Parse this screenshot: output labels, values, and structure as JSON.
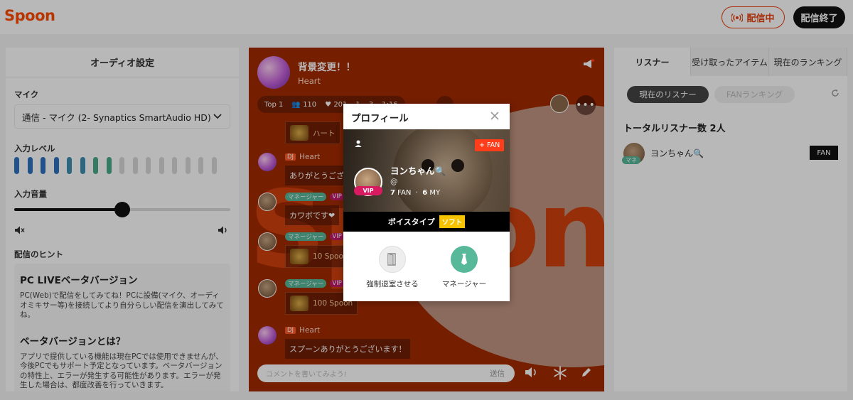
{
  "header": {
    "logo": "Spoon",
    "live_label": "配信中",
    "end_label": "配信終了"
  },
  "audio": {
    "title": "オーディオ設定",
    "mic_label": "マイク",
    "mic_value": "通信 - マイク (2- Synaptics SmartAudio HD)",
    "input_level_label": "入力レベル",
    "level_bars_active": 8,
    "level_bars_total": 16,
    "volume_label": "入力音量",
    "volume_fraction": 0.5,
    "tips_title": "配信のヒント",
    "tip1_title": "PC LIVEベータバージョン",
    "tip1_body": "PC(Web)で配信をしてみてね！PCに設備(マイク、オーディオミキサー等)を接続してより自分らしい配信を演出してみてね。",
    "tip2_title": "ベータバージョンとは？",
    "tip2_body": "アプリで提供している機能は現在PCでは使用できませんが、今後PCでもサポート予定となっています。ベータバージョンの特性上、エラーが発生する可能性があります。エラーが発生した場合は、都度改善を行っていきます。"
  },
  "room": {
    "title": "背景変更！！",
    "subtitle": "Heart",
    "bg_word": "Spoon",
    "stat_rank": "Top 1",
    "stat_listeners": "110",
    "stat_likes": "201",
    "stat_a": "1",
    "stat_b": "3",
    "stat_c": "1:16",
    "more": "•••",
    "messages": {
      "gift_top": "ハート",
      "m1_tag": "DJ",
      "m1_name": "Heart",
      "m1_text": "ありがとうございます",
      "m2_tag": "マネージャー",
      "m2_vip": "VIP",
      "m2_text": "カワボです❤",
      "m3_tag": "マネージャー",
      "m3_vip": "VIP",
      "m3_gift": "10 Spoon",
      "m4_tag": "マネージャー",
      "m4_vip": "VIP",
      "m4_gift": "100 Spoon",
      "m5_tag": "DJ",
      "m5_name": "Heart",
      "m5_text": "スプーンありがとうございます！"
    },
    "composer_placeholder": "コメントを書いてみよう!",
    "send_label": "送信"
  },
  "listeners": {
    "tabs": [
      "リスナー",
      "受け取ったアイテム",
      "現在のランキング"
    ],
    "filter_current": "現在のリスナー",
    "filter_fan": "FANランキング",
    "total_label": "トータルリスナー数 2人",
    "list": [
      {
        "name": "ヨンちゃん🔍",
        "badge": "マネ",
        "action": "FAN"
      }
    ]
  },
  "profile": {
    "title": "プロフィール",
    "fan_button": "+ FAN",
    "vip": "VIP",
    "name": "ヨンちゃん🔍",
    "handle": "@",
    "fan_count": "7",
    "fan_label": "FAN",
    "my_count": "6",
    "my_label": "MY",
    "voice_label": "ボイスタイプ",
    "voice_type": "ソフト",
    "action_kick": "強制退室させる",
    "action_manager": "マネージャー"
  },
  "colors": {
    "brand": "#ff4a00",
    "accent_red": "#e8410c",
    "manager_green": "#57b89a",
    "vip_pink": "#d81b60",
    "voice_yellow": "#f7c300"
  }
}
